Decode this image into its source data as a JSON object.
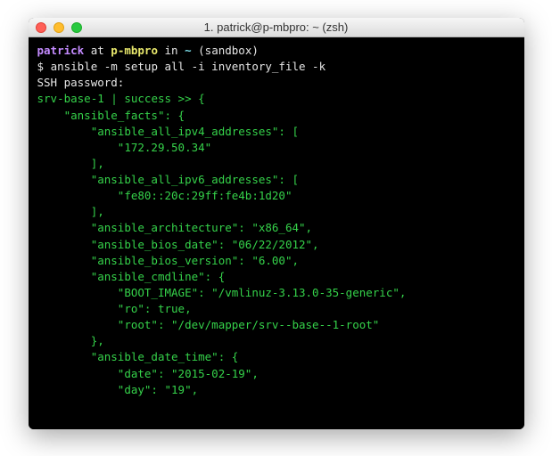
{
  "window": {
    "title": "1. patrick@p-mbpro: ~ (zsh)"
  },
  "prompt": {
    "user": "patrick",
    "at": " at ",
    "host": "p-mbpro",
    "in_word": " in ",
    "path": "~",
    "env": " (sandbox)"
  },
  "command": {
    "symbol": "$ ",
    "text": "ansible -m setup all -i inventory_file -k"
  },
  "ssh_line": "SSH password:",
  "result_head": {
    "host": "srv-base-1",
    "sep": " | ",
    "status": "success",
    "tail": " >> {"
  },
  "facts": {
    "open": "    \"ansible_facts\": {",
    "ipv4_key": "        \"ansible_all_ipv4_addresses\": [",
    "ipv4_val": "            \"172.29.50.34\"",
    "ipv4_close": "        ],",
    "ipv6_key": "        \"ansible_all_ipv6_addresses\": [",
    "ipv6_val": "            \"fe80::20c:29ff:fe4b:1d20\"",
    "ipv6_close": "        ],",
    "arch": "        \"ansible_architecture\": \"x86_64\",",
    "bios_date": "        \"ansible_bios_date\": \"06/22/2012\",",
    "bios_ver": "        \"ansible_bios_version\": \"6.00\",",
    "cmdline_key": "        \"ansible_cmdline\": {",
    "boot_image": "            \"BOOT_IMAGE\": \"/vmlinuz-3.13.0-35-generic\",",
    "ro_line": {
      "pre": "            \"ro\": ",
      "val": "true",
      "post": ","
    },
    "root": "            \"root\": \"/dev/mapper/srv--base--1-root\"",
    "cmdline_close": "        },",
    "datetime_key": "        \"ansible_date_time\": {",
    "date": "            \"date\": \"2015-02-19\",",
    "day": "            \"day\": \"19\","
  }
}
